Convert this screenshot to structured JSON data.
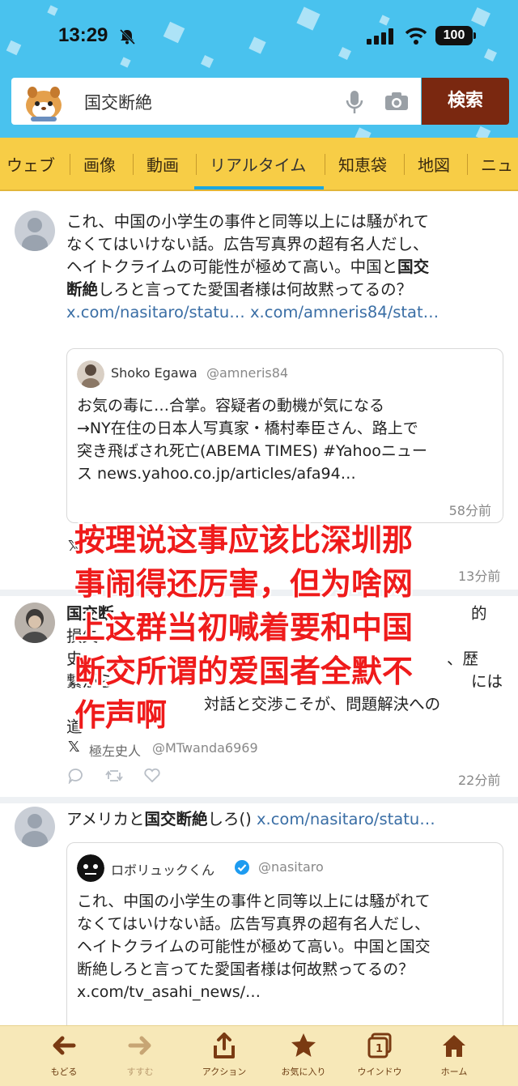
{
  "status_bar": {
    "time": "13:29",
    "battery": "100"
  },
  "search": {
    "query": "国交断絶",
    "button_label": "検索"
  },
  "tabs": [
    {
      "label": "ウェブ"
    },
    {
      "label": "画像"
    },
    {
      "label": "動画"
    },
    {
      "label": "リアルタイム"
    },
    {
      "label": "知恵袋"
    },
    {
      "label": "地図"
    },
    {
      "label": "ニュ"
    }
  ],
  "posts": [
    {
      "lines": [
        "これ、中国の小学生の事件と同等以上には騒がれて",
        "なくてはいけない話。広告写真界の超有名人だし、",
        "ヘイトクライムの可能性が極めて高い。中国と"
      ],
      "highlight_1": "国交",
      "highlight_2": "断絶",
      "line4_rest": "しろと言ってた愛国者様は何故黙ってるの？",
      "link_1": "x.com/nasitaro/statu…",
      "link_2": "x.com/amneris84/stat…",
      "quote": {
        "name": "Shoko Egawa",
        "handle": "@amneris84",
        "lines": [
          "お気の毒に…合掌。容疑者の動機が気になる",
          "→NY在住の日本人写真家・橋村奉臣さん、路上で",
          "突き飛ばされ死亡(ABEMA TIMES) #Yahooニュー",
          "ス news.yahoo.co.jp/articles/afa94…"
        ],
        "time": "58分前"
      },
      "time": "13分前"
    },
    {
      "lines": [
        "国交断",
        "損失",
        "史",
        "繋がら",
        "道"
      ],
      "visible_tail_1": "対話と交渉こそが、問題解決への",
      "visible_tail_2": "的",
      "visible_tail_3": "、歴",
      "visible_tail_4": "には",
      "author": "極左史人",
      "handle": "@MTwanda6969",
      "time": "22分前"
    },
    {
      "text_prefix": "アメリカと",
      "highlight": "国交断絶",
      "text_suffix": "しろ()",
      "link": "x.com/nasitaro/statu…",
      "quote": {
        "name": "ロボリュックくん",
        "handle": "@nasitaro",
        "lines": [
          "これ、中国の小学生の事件と同等以上には騒がれて",
          "なくてはいけない話。広告写真界の超有名人だし、",
          "ヘイトクライムの可能性が極めて高い。中国と国交",
          "断絶しろと言ってた愛国者様は何故黙ってるの？",
          "x.com/tv_asahi_news/…"
        ]
      }
    }
  ],
  "overlay_caption": [
    "按理说这事应该比深圳那",
    "事闹得还厉害，但为啥网",
    "上这群当初喊着要和中国",
    "断交所谓的爱国者全默不",
    "作声啊"
  ],
  "bottom_nav": [
    {
      "label": "もどる",
      "icon": "back-arrow-icon"
    },
    {
      "label": "すすむ",
      "icon": "forward-arrow-icon"
    },
    {
      "label": "アクション",
      "icon": "share-icon"
    },
    {
      "label": "お気に入り",
      "icon": "star-icon"
    },
    {
      "label": "ウインドウ",
      "icon": "window-icon",
      "count": "1"
    },
    {
      "label": "ホーム",
      "icon": "home-icon"
    }
  ],
  "colors": {
    "header_blue": "#49c2ee",
    "tab_yellow": "#f7cd46",
    "search_button": "#7a2810",
    "link_blue": "#3a6ea5",
    "overlay_red": "#ef1b1b",
    "active_tab_underline": "#1aa7e0",
    "verified_badge": "#1d9bf0"
  }
}
